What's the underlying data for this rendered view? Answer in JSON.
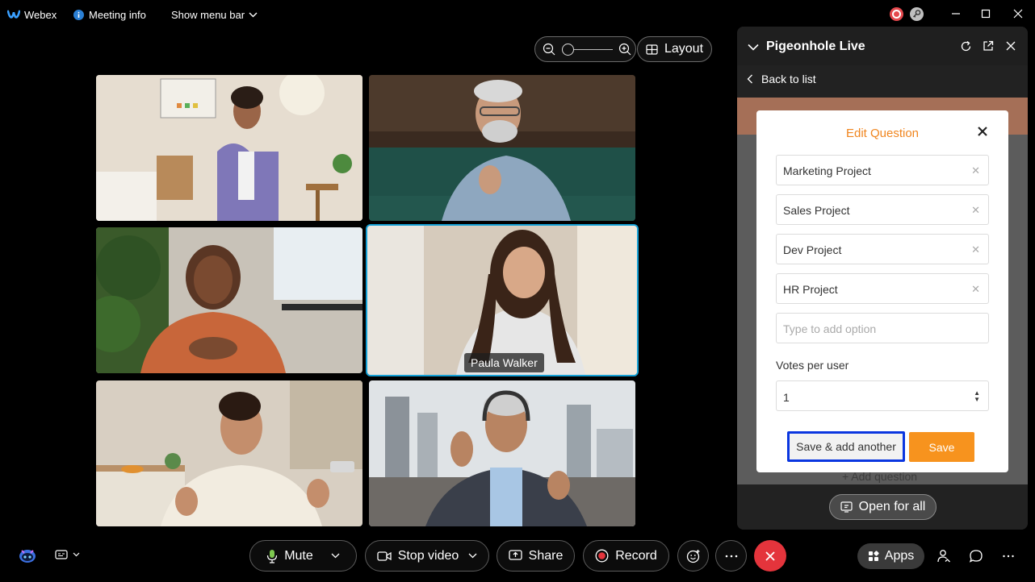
{
  "topbar": {
    "app_name": "Webex",
    "meeting_info_label": "Meeting info",
    "show_menu_label": "Show menu bar"
  },
  "stage": {
    "layout_label": "Layout"
  },
  "participants": [
    {
      "name": ""
    },
    {
      "name": ""
    },
    {
      "name": ""
    },
    {
      "name": "Paula Walker"
    },
    {
      "name": ""
    },
    {
      "name": ""
    }
  ],
  "panel": {
    "title": "Pigeonhole Live",
    "back_label": "Back to list",
    "add_question_label": "Add question",
    "open_for_all_label": "Open for all"
  },
  "modal": {
    "title": "Edit Question",
    "options": [
      {
        "text": "Marketing Project"
      },
      {
        "text": "Sales Project"
      },
      {
        "text": "Dev Project"
      },
      {
        "text": "HR Project"
      }
    ],
    "new_option_placeholder": "Type to add option",
    "votes_label": "Votes per user",
    "votes_value": "1",
    "save_add_label": "Save & add another",
    "save_label": "Save"
  },
  "controls": {
    "mute_label": "Mute",
    "stop_video_label": "Stop video",
    "share_label": "Share",
    "record_label": "Record",
    "apps_label": "Apps"
  },
  "colors": {
    "accent_orange": "#f7931e",
    "active_speaker": "#14a0d6",
    "end_call": "#e4343c",
    "highlight_blue": "#0a36e0"
  }
}
